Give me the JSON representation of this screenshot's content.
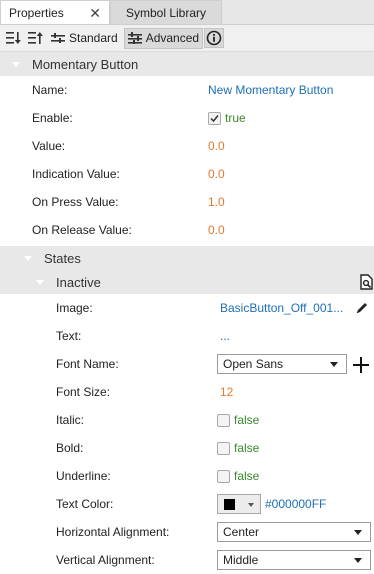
{
  "tabs": [
    {
      "label": "Properties",
      "close_glyph": "✕"
    },
    {
      "label": "Symbol Library"
    }
  ],
  "toolbar": {
    "standard_label": "Standard",
    "advanced_label": "Advanced"
  },
  "component": {
    "title": "Momentary Button",
    "props": [
      {
        "label": "Name:",
        "value": "New Momentary Button"
      },
      {
        "label": "Enable:",
        "value": "true"
      },
      {
        "label": "Value:",
        "value": "0.0"
      },
      {
        "label": "Indication Value:",
        "value": "0.0"
      },
      {
        "label": "On Press Value:",
        "value": "1.0"
      },
      {
        "label": "On Release Value:",
        "value": "0.0"
      }
    ]
  },
  "states": {
    "title": "States",
    "inactive": {
      "title": "Inactive",
      "props": [
        {
          "label": "Image:",
          "value": "BasicButton_Off_001..."
        },
        {
          "label": "Text:",
          "value": "..."
        },
        {
          "label": "Font Name:",
          "value": "Open Sans"
        },
        {
          "label": "Font Size:",
          "value": "12"
        },
        {
          "label": "Italic:",
          "value": "false"
        },
        {
          "label": "Bold:",
          "value": "false"
        },
        {
          "label": "Underline:",
          "value": "false"
        },
        {
          "label": "Text Color:",
          "value": "#000000FF"
        },
        {
          "label": "Horizontal Alignment:",
          "value": "Center"
        },
        {
          "label": "Vertical Alignment:",
          "value": "Middle"
        }
      ]
    }
  },
  "colors": {
    "link_blue": "#1e6fb8",
    "number_orange": "#e07a2c",
    "bool_green": "#3a8a2b",
    "header_bg": "#e8e8e8"
  }
}
